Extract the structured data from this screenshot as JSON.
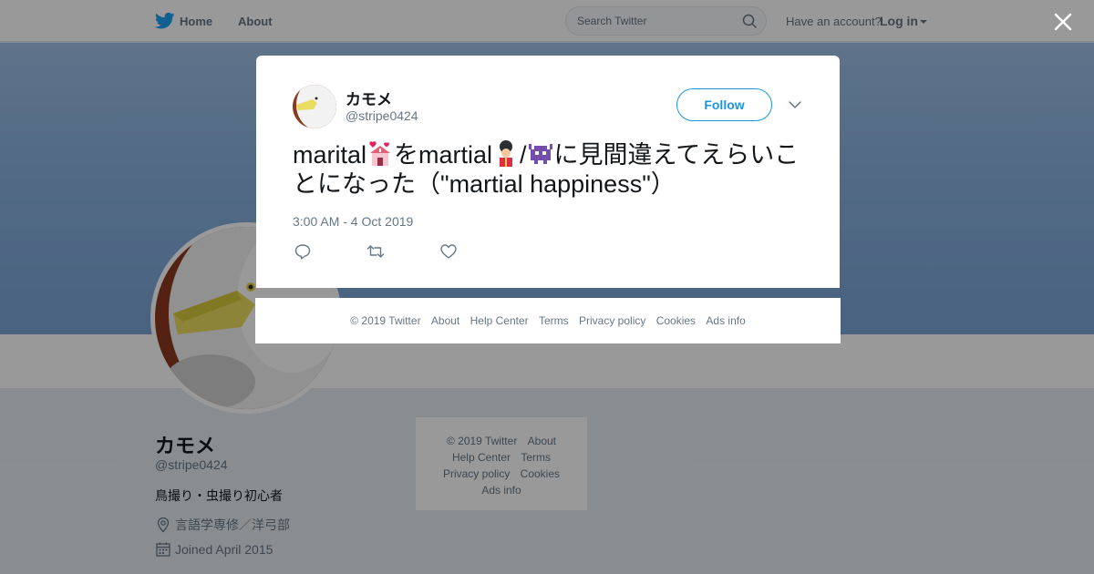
{
  "topbar": {
    "home_label": "Home",
    "about_label": "About",
    "search_placeholder": "Search Twitter",
    "have_account": "Have an account?",
    "login_label": "Log in"
  },
  "profile": {
    "name": "カモメ",
    "handle": "@stripe0424",
    "bio": "鳥撮り・虫撮り初心者",
    "location": "言語学専修／洋弓部",
    "joined": "Joined April 2015"
  },
  "side_footer": {
    "copyright": "© 2019 Twitter",
    "about": "About",
    "help_center": "Help Center",
    "terms": "Terms",
    "privacy": "Privacy policy",
    "cookies": "Cookies",
    "ads_info": "Ads info"
  },
  "tweet": {
    "author_name": "カモメ",
    "author_handle": "@stripe0424",
    "follow_label": "Follow",
    "text_part1": "marital",
    "text_part2": "をmartial",
    "text_part3": "/",
    "text_part4": "に見間違えてえらいことになった（\"martial happiness\"）",
    "timestamp": "3:00 AM - 4 Oct 2019"
  },
  "modal_footer": {
    "copyright": "© 2019 Twitter",
    "about": "About",
    "help_center": "Help Center",
    "terms": "Terms",
    "privacy": "Privacy policy",
    "cookies": "Cookies",
    "ads_info": "Ads info"
  },
  "icons": {
    "brand": "twitter-bird-icon",
    "accent_color": "#1b95e0"
  }
}
